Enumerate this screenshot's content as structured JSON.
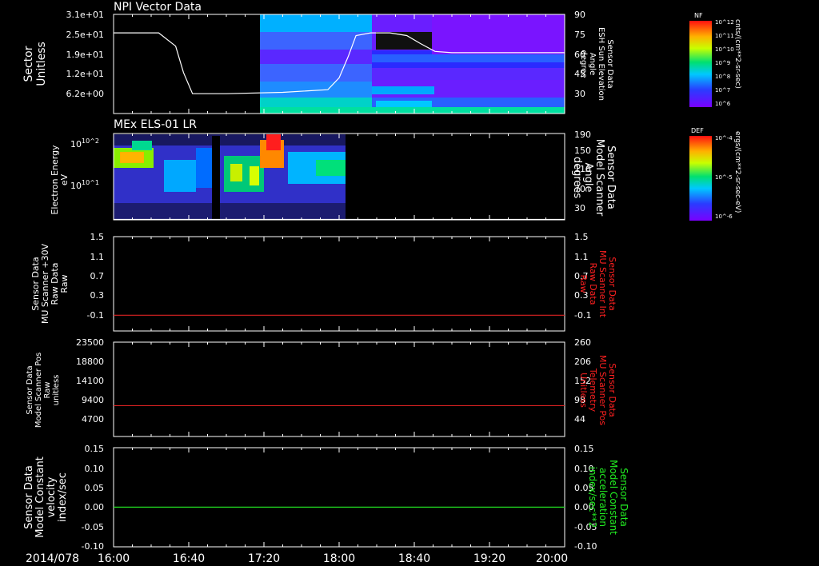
{
  "time_axis": {
    "date_label": "2014/078",
    "ticks": [
      "16:00",
      "16:40",
      "17:20",
      "18:00",
      "18:40",
      "19:20",
      "20:00"
    ],
    "range_hours": [
      16,
      20
    ]
  },
  "colors": {
    "background": "#000000",
    "axis": "#ffffff",
    "red_trace": "#dd2222",
    "green_trace": "#22dd22",
    "red_label": "#ff2020",
    "green_label": "#22ee22"
  },
  "chart_data": [
    {
      "type": "heatmap",
      "panel_title": "NPI Vector Data",
      "ylabel_left": [
        "Sector",
        "Unitless"
      ],
      "yticks_left": [
        "3.1e+01",
        "2.5e+01",
        "1.9e+01",
        "1.2e+01",
        "6.2e+00"
      ],
      "ylabel_right": [
        "Sensor Data",
        "ESH Sun Elevation",
        "Angle",
        "degree"
      ],
      "yticks_right": [
        "90",
        "75",
        "60",
        "45",
        "30"
      ],
      "yrange_right": [
        15,
        90
      ],
      "data_start_time": 17.17,
      "overlay_line": {
        "name": "Sensor Data ESH Sun Elevation Angle",
        "x": [
          16.0,
          16.4,
          16.55,
          16.62,
          16.7,
          17.0,
          17.5,
          17.9,
          18.0,
          18.08,
          18.15,
          18.28,
          18.45,
          18.6,
          18.72,
          18.85,
          19.0,
          20.0
        ],
        "y": [
          76,
          76,
          66,
          46,
          30,
          30,
          31,
          33,
          42,
          58,
          74,
          76,
          76,
          74,
          68,
          62,
          61,
          61
        ]
      },
      "colorbar": {
        "label": "NF",
        "units": "cnts/(cm**2-sr-sec)",
        "ticks": [
          "10^12",
          "10^11",
          "10^10",
          "10^9",
          "10^8",
          "10^7",
          "10^6"
        ]
      }
    },
    {
      "type": "heatmap",
      "panel_title": "MEx ELS-01 LR",
      "ylabel_left": [
        "Electron Energy",
        "eV"
      ],
      "yticks_left": [
        "10^2",
        "10^1"
      ],
      "ylabel_right": [
        "Sensor Data",
        "Model Scanner",
        "Angle",
        "degrees"
      ],
      "yticks_right": [
        "190",
        "150",
        "110",
        "70",
        "30"
      ],
      "yrange_right": [
        0,
        190
      ],
      "data_time_range": [
        16.0,
        18.08
      ],
      "overlay_line": {
        "name": "Sensor Data Model Scanner Angle",
        "x": [
          16.0,
          20.0
        ],
        "y": [
          1,
          1
        ]
      },
      "colorbar": {
        "label": "DEF",
        "units": "ergs/(cm**2-sr-sec-eV)",
        "ticks": [
          "10^-4",
          "10^-5",
          "10^-6"
        ]
      }
    },
    {
      "type": "line",
      "ylabel_left": [
        "Sensor Data",
        "MU Scanner +30V",
        "Raw Data",
        "Raw"
      ],
      "yticks_left": [
        "1.5",
        "1.1",
        "0.7",
        "0.3",
        "-0.1"
      ],
      "yrange_left": [
        -0.3,
        1.5
      ],
      "ylabel_right": [
        "Sensor Data",
        "MU Scanner Int",
        "Raw Data",
        "Raw"
      ],
      "yticks_right": [
        "1.5",
        "1.1",
        "0.7",
        "0.3",
        "-0.1"
      ],
      "series": [
        {
          "name": "Sensor Data MU Scanner Int Raw Data",
          "x": [
            16.0,
            20.0
          ],
          "y": [
            0.0,
            0.0
          ],
          "color": "#dd2222"
        }
      ]
    },
    {
      "type": "line",
      "ylabel_left": [
        "Sensor Data",
        "Model Scanner Pos",
        "Raw",
        "unitless"
      ],
      "yticks_left": [
        "23500",
        "18800",
        "14100",
        "9400",
        "4700"
      ],
      "yrange_left": [
        0,
        23500
      ],
      "ylabel_right": [
        "Sensor Data",
        "MU Scanner Pos",
        "Telemetry",
        "Unitless"
      ],
      "yticks_right": [
        "260",
        "206",
        "152",
        "98",
        "44"
      ],
      "yrange_right": [
        0,
        260
      ],
      "series": [
        {
          "name": "Sensor Data MU Scanner Pos Telemetry",
          "x": [
            16.0,
            20.0
          ],
          "y": [
            85,
            85
          ],
          "color": "#dd2222"
        }
      ]
    },
    {
      "type": "line",
      "ylabel_left": [
        "Sensor Data",
        "Model Constant",
        "velocity",
        "index/sec"
      ],
      "yticks_left": [
        "0.15",
        "0.10",
        "0.05",
        "0.00",
        "-0.05",
        "-0.10"
      ],
      "yrange_left": [
        -0.1,
        0.15
      ],
      "ylabel_right": [
        "Sensor Data",
        "Model Constant",
        "acceleration",
        "index/sec**2"
      ],
      "yticks_right": [
        "0.15",
        "0.10",
        "0.05",
        "0.00",
        "-0.05",
        "-0.10"
      ],
      "series": [
        {
          "name": "Sensor Data Model Constant acceleration",
          "x": [
            16.0,
            20.0
          ],
          "y": [
            0.0,
            0.0
          ],
          "color": "#22dd22"
        }
      ]
    }
  ]
}
